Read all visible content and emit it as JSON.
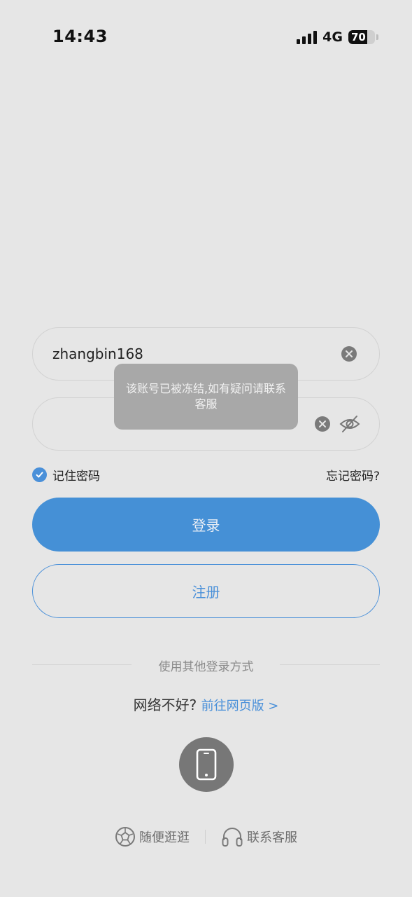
{
  "status_bar": {
    "time": "14:43",
    "network": "4G",
    "battery_text": "70",
    "battery_level": 0.7
  },
  "login_form": {
    "username_value": "zhangbin168",
    "password_value": "",
    "remember_label": "记住密码",
    "remember_checked": true,
    "forgot_label": "忘记密码?",
    "login_label": "登录",
    "register_label": "注册"
  },
  "toast": {
    "message": "该账号已被冻结,如有疑问请联系客服"
  },
  "alt_login": {
    "divider_text": "使用其他登录方式",
    "network_prompt": "网络不好?",
    "web_link": "前往网页版 >"
  },
  "footer": {
    "browse_label": "随便逛逛",
    "support_label": "联系客服"
  },
  "colors": {
    "background": "#e6e6e6",
    "accent": "#4a90d9",
    "login_button": "#4590d6",
    "toast_bg": "#a8a8a8"
  },
  "icons": {
    "clear": "clear-circle-icon",
    "eye": "eye-off-icon",
    "check": "check-circle-icon",
    "phone": "smartphone-icon",
    "browse": "football-icon",
    "support": "headset-icon"
  }
}
